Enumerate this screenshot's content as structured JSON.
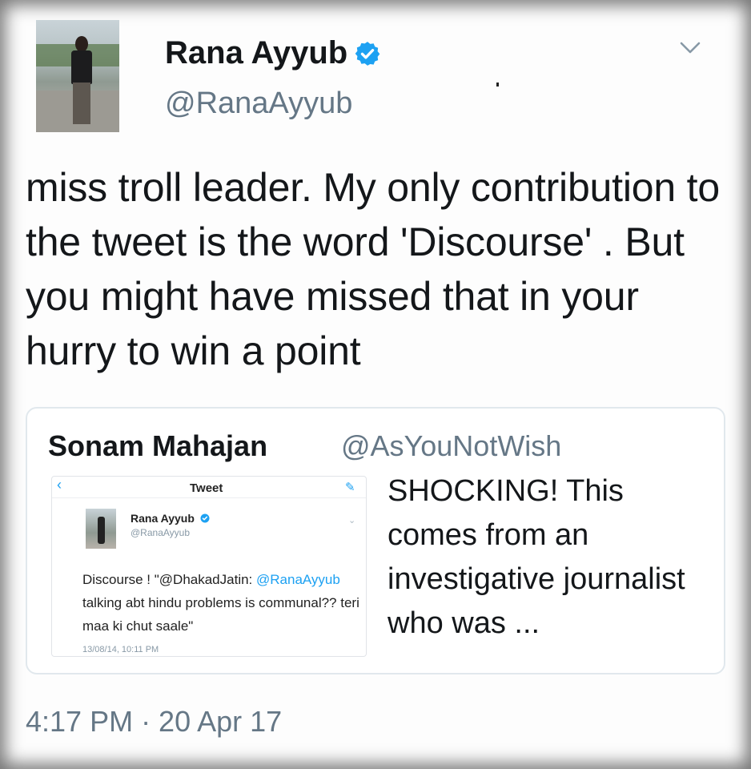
{
  "tweet": {
    "author_name": "Rana Ayyub",
    "author_handle": "@RanaAyyub",
    "verified": true,
    "text": "miss troll leader. My only contribution to the tweet is the word 'Discourse' . But you might have missed that in your hurry to win a point",
    "timestamp": "4:17 PM · 20 Apr 17",
    "menu_icon": "chevron-down-icon"
  },
  "quoted_tweet": {
    "author_name": "Sonam Mahajan",
    "author_handle": "@AsYouNotWish",
    "text": "SHOCKING! This comes from an investigative journalist who was ...",
    "embedded_screenshot": {
      "header_title": "Tweet",
      "back_icon": "back-chevron-icon",
      "compose_icon": "compose-icon",
      "author_name": "Rana Ayyub",
      "author_handle": "@RanaAyyub",
      "body_prefix": "Discourse ! \"@DhakadJatin: ",
      "body_mention": "@RanaAyyub",
      "body_suffix": " talking abt hindu problems is communal?? teri maa ki chut saale\"",
      "timestamp": "13/08/14, 10:11 PM"
    }
  },
  "colors": {
    "text": "#14171a",
    "secondary": "#657786",
    "accent": "#1da1f2",
    "border": "#e1e8ed"
  }
}
